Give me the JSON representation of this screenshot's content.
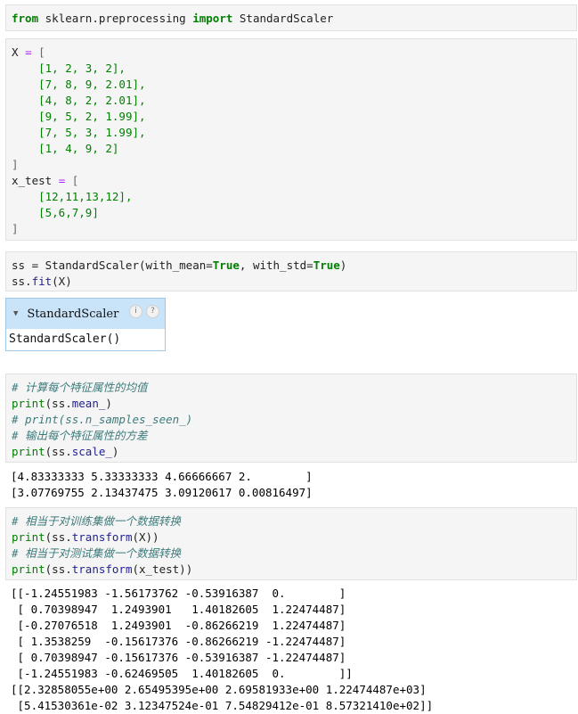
{
  "cell1": {
    "kw_from": "from",
    "module": "sklearn.preprocessing",
    "kw_import": "import",
    "name": "StandardScaler"
  },
  "cell2": {
    "X_name": "X",
    "X_rows": [
      "[1, 2, 3, 2],",
      "[7, 8, 9, 2.01],",
      "[4, 8, 2, 2.01],",
      "[9, 5, 2, 1.99],",
      "[7, 5, 3, 1.99],",
      "[1, 4, 9, 2]"
    ],
    "xtest_name": "x_test",
    "xtest_rows": [
      "[12,11,13,12],",
      "[5,6,7,9]"
    ]
  },
  "cell3": {
    "line1_pre": "ss = StandardScaler(with_mean=",
    "true1": "True",
    "line1_mid": ", with_std=",
    "true2": "True",
    "line1_post": ")",
    "line2_obj": "ss.",
    "line2_fn": "fit",
    "line2_arg": "(X)"
  },
  "widget": {
    "title": "StandardScaler",
    "body": "StandardScaler()",
    "icon1": "i",
    "icon2": "?"
  },
  "cell4": {
    "comment1": "# 计算每个特征属性的均值",
    "print1_fn": "print",
    "print1_obj": "(ss.",
    "print1_attr": "mean_",
    "print1_end": ")",
    "comment2": "# print(ss.n_samples_seen_)",
    "comment3": "# 输出每个特征属性的方差",
    "print2_fn": "print",
    "print2_obj": "(ss.",
    "print2_attr": "scale_",
    "print2_end": ")"
  },
  "out4": [
    "[4.83333333 5.33333333 4.66666667 2.        ]",
    "[3.07769755 2.13437475 3.09120617 0.00816497]"
  ],
  "cell5": {
    "comment1": "# 相当于对训练集做一个数据转换",
    "print1_fn": "print",
    "print1_obj": "(ss.",
    "print1_attr": "transform",
    "print1_end": "(X))",
    "comment2": "# 相当于对测试集做一个数据转换",
    "print2_fn": "print",
    "print2_obj": "(ss.",
    "print2_attr": "transform",
    "print2_end": "(x_test))"
  },
  "out5": [
    "[[-1.24551983 -1.56173762 -0.53916387  0.        ]",
    " [ 0.70398947  1.2493901   1.40182605  1.22474487]",
    " [-0.27076518  1.2493901  -0.86266219  1.22474487]",
    " [ 1.3538259  -0.15617376 -0.86266219 -1.22474487]",
    " [ 0.70398947 -0.15617376 -0.53916387 -1.22474487]",
    " [-1.24551983 -0.62469505  1.40182605  0.        ]]",
    "[[2.32858055e+00 2.65495395e+00 2.69581933e+00 1.22474487e+03]",
    " [5.41530361e-02 3.12347524e-01 7.54829412e-01 8.57321410e+02]]"
  ]
}
